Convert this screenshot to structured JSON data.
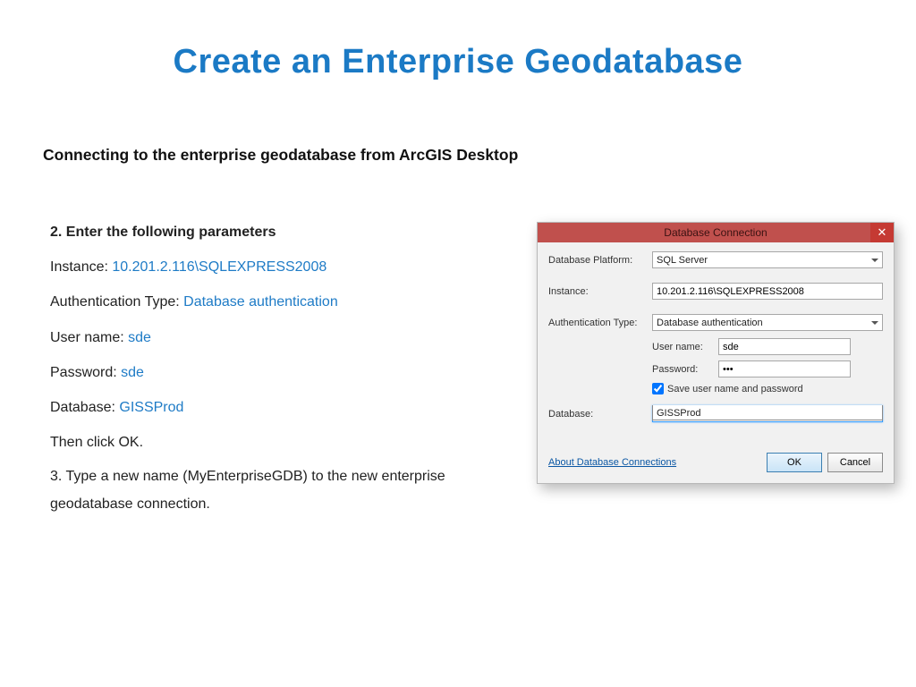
{
  "title": "Create an Enterprise Geodatabase",
  "subtitle": "Connecting to the enterprise geodatabase from ArcGIS Desktop",
  "instructions": {
    "step_header": "2.  Enter the following parameters",
    "lines": [
      {
        "label": "Instance: ",
        "value": "10.201.2.116\\SQLEXPRESS2008"
      },
      {
        "label": "Authentication Type: ",
        "value": "Database authentication"
      },
      {
        "label": "User name: ",
        "value": "sde"
      },
      {
        "label": "Password: ",
        "value": "sde"
      },
      {
        "label": "Database: ",
        "value": "GISSProd"
      }
    ],
    "then_ok": "Then click OK.",
    "step3": "3.  Type a new name (MyEnterpriseGDB) to the new enterprise geodatabase connection."
  },
  "dialog": {
    "title": "Database Connection",
    "labels": {
      "platform": "Database Platform:",
      "instance": "Instance:",
      "auth": "Authentication Type:",
      "user": "User name:",
      "pass": "Password:",
      "save": "Save user name and password",
      "database": "Database:"
    },
    "values": {
      "platform": "SQL Server",
      "instance": "10.201.2.116\\SQLEXPRESS2008",
      "auth": "Database authentication",
      "user": "sde",
      "pass": "•••",
      "save_checked": true,
      "database_selected": "",
      "database_option": "GISSProd"
    },
    "footer": {
      "about_link": "About Database Connections",
      "ok": "OK",
      "cancel": "Cancel"
    }
  }
}
